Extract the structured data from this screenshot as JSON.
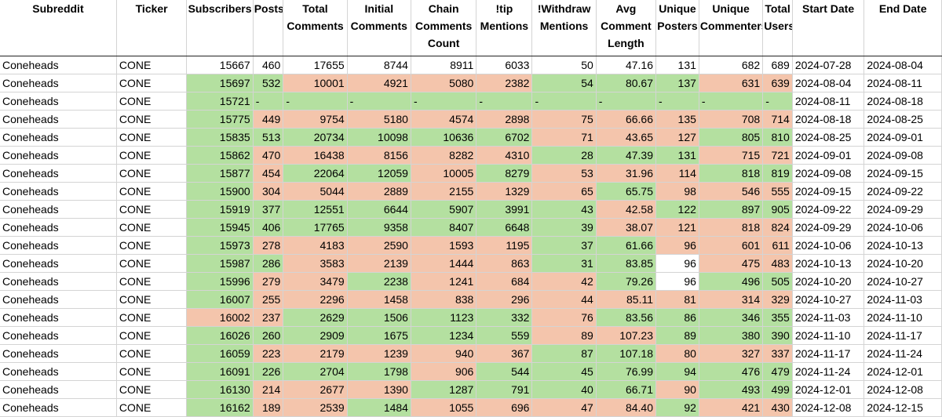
{
  "colors": {
    "green": "#b4e0a0",
    "salmon": "#f4c5ac"
  },
  "headers": [
    "Subreddit",
    "Ticker",
    "Subscribers",
    "Posts",
    "Total Comments",
    "Initial Comments",
    "Chain Comments Count",
    "!tip Mentions",
    "!Withdraw Mentions",
    "Avg Comment Length",
    "Unique Posters",
    "Unique Commenters",
    "Total Users",
    "Start Date",
    "End Date"
  ],
  "rows": [
    {
      "cells": [
        "Coneheads",
        "CONE",
        "15667",
        "460",
        "17655",
        "8744",
        "8911",
        "6033",
        "50",
        "47.16",
        "131",
        "682",
        "689",
        "2024-07-28",
        "2024-08-04"
      ],
      "shade": [
        "",
        "",
        "",
        "",
        "",
        "",
        "",
        "",
        "",
        "",
        "",
        "",
        "",
        "",
        ""
      ]
    },
    {
      "cells": [
        "Coneheads",
        "CONE",
        "15697",
        "532",
        "10001",
        "4921",
        "5080",
        "2382",
        "54",
        "80.67",
        "137",
        "631",
        "639",
        "2024-08-04",
        "2024-08-11"
      ],
      "shade": [
        "",
        "",
        "g",
        "g",
        "p",
        "p",
        "p",
        "p",
        "g",
        "g",
        "g",
        "p",
        "p",
        "",
        ""
      ]
    },
    {
      "cells": [
        "Coneheads",
        "CONE",
        "15721",
        "-",
        "-",
        "-",
        "-",
        "-",
        "-",
        "-",
        "-",
        "-",
        "-",
        "2024-08-11",
        "2024-08-18"
      ],
      "shade": [
        "",
        "",
        "g",
        "g",
        "g",
        "g",
        "g",
        "g",
        "g",
        "g",
        "g",
        "g",
        "g",
        "",
        ""
      ]
    },
    {
      "cells": [
        "Coneheads",
        "CONE",
        "15775",
        "449",
        "9754",
        "5180",
        "4574",
        "2898",
        "75",
        "66.66",
        "135",
        "708",
        "714",
        "2024-08-18",
        "2024-08-25"
      ],
      "shade": [
        "",
        "",
        "g",
        "p",
        "p",
        "p",
        "p",
        "p",
        "p",
        "p",
        "p",
        "p",
        "p",
        "",
        ""
      ]
    },
    {
      "cells": [
        "Coneheads",
        "CONE",
        "15835",
        "513",
        "20734",
        "10098",
        "10636",
        "6702",
        "71",
        "43.65",
        "127",
        "805",
        "810",
        "2024-08-25",
        "2024-09-01"
      ],
      "shade": [
        "",
        "",
        "g",
        "g",
        "g",
        "g",
        "g",
        "g",
        "p",
        "p",
        "p",
        "g",
        "g",
        "",
        ""
      ]
    },
    {
      "cells": [
        "Coneheads",
        "CONE",
        "15862",
        "470",
        "16438",
        "8156",
        "8282",
        "4310",
        "28",
        "47.39",
        "131",
        "715",
        "721",
        "2024-09-01",
        "2024-09-08"
      ],
      "shade": [
        "",
        "",
        "g",
        "p",
        "p",
        "p",
        "p",
        "p",
        "g",
        "g",
        "g",
        "p",
        "p",
        "",
        ""
      ]
    },
    {
      "cells": [
        "Coneheads",
        "CONE",
        "15877",
        "454",
        "22064",
        "12059",
        "10005",
        "8279",
        "53",
        "31.96",
        "114",
        "818",
        "819",
        "2024-09-08",
        "2024-09-15"
      ],
      "shade": [
        "",
        "",
        "g",
        "p",
        "g",
        "g",
        "p",
        "g",
        "p",
        "p",
        "p",
        "g",
        "g",
        "",
        ""
      ]
    },
    {
      "cells": [
        "Coneheads",
        "CONE",
        "15900",
        "304",
        "5044",
        "2889",
        "2155",
        "1329",
        "65",
        "65.75",
        "98",
        "546",
        "555",
        "2024-09-15",
        "2024-09-22"
      ],
      "shade": [
        "",
        "",
        "g",
        "p",
        "p",
        "p",
        "p",
        "p",
        "p",
        "g",
        "p",
        "p",
        "p",
        "",
        ""
      ]
    },
    {
      "cells": [
        "Coneheads",
        "CONE",
        "15919",
        "377",
        "12551",
        "6644",
        "5907",
        "3991",
        "43",
        "42.58",
        "122",
        "897",
        "905",
        "2024-09-22",
        "2024-09-29"
      ],
      "shade": [
        "",
        "",
        "g",
        "g",
        "g",
        "g",
        "g",
        "g",
        "g",
        "p",
        "g",
        "g",
        "g",
        "",
        ""
      ]
    },
    {
      "cells": [
        "Coneheads",
        "CONE",
        "15945",
        "406",
        "17765",
        "9358",
        "8407",
        "6648",
        "39",
        "38.07",
        "121",
        "818",
        "824",
        "2024-09-29",
        "2024-10-06"
      ],
      "shade": [
        "",
        "",
        "g",
        "g",
        "g",
        "g",
        "g",
        "g",
        "g",
        "p",
        "p",
        "p",
        "p",
        "",
        ""
      ]
    },
    {
      "cells": [
        "Coneheads",
        "CONE",
        "15973",
        "278",
        "4183",
        "2590",
        "1593",
        "1195",
        "37",
        "61.66",
        "96",
        "601",
        "611",
        "2024-10-06",
        "2024-10-13"
      ],
      "shade": [
        "",
        "",
        "g",
        "p",
        "p",
        "p",
        "p",
        "p",
        "g",
        "g",
        "p",
        "p",
        "p",
        "",
        ""
      ]
    },
    {
      "cells": [
        "Coneheads",
        "CONE",
        "15987",
        "286",
        "3583",
        "2139",
        "1444",
        "863",
        "31",
        "83.85",
        "96",
        "475",
        "483",
        "2024-10-13",
        "2024-10-20"
      ],
      "shade": [
        "",
        "",
        "g",
        "g",
        "p",
        "p",
        "p",
        "p",
        "g",
        "g",
        "w",
        "p",
        "p",
        "",
        ""
      ]
    },
    {
      "cells": [
        "Coneheads",
        "CONE",
        "15996",
        "279",
        "3479",
        "2238",
        "1241",
        "684",
        "42",
        "79.26",
        "96",
        "496",
        "505",
        "2024-10-20",
        "2024-10-27"
      ],
      "shade": [
        "",
        "",
        "g",
        "p",
        "p",
        "g",
        "p",
        "p",
        "p",
        "g",
        "w",
        "g",
        "g",
        "",
        ""
      ]
    },
    {
      "cells": [
        "Coneheads",
        "CONE",
        "16007",
        "255",
        "2296",
        "1458",
        "838",
        "296",
        "44",
        "85.11",
        "81",
        "314",
        "329",
        "2024-10-27",
        "2024-11-03"
      ],
      "shade": [
        "",
        "",
        "g",
        "p",
        "p",
        "p",
        "p",
        "p",
        "p",
        "p",
        "p",
        "p",
        "p",
        "",
        ""
      ]
    },
    {
      "cells": [
        "Coneheads",
        "CONE",
        "16002",
        "237",
        "2629",
        "1506",
        "1123",
        "332",
        "76",
        "83.56",
        "86",
        "346",
        "355",
        "2024-11-03",
        "2024-11-10"
      ],
      "shade": [
        "",
        "",
        "p",
        "p",
        "g",
        "g",
        "g",
        "g",
        "p",
        "g",
        "g",
        "g",
        "g",
        "",
        ""
      ]
    },
    {
      "cells": [
        "Coneheads",
        "CONE",
        "16026",
        "260",
        "2909",
        "1675",
        "1234",
        "559",
        "89",
        "107.23",
        "89",
        "380",
        "390",
        "2024-11-10",
        "2024-11-17"
      ],
      "shade": [
        "",
        "",
        "g",
        "g",
        "g",
        "g",
        "g",
        "g",
        "p",
        "p",
        "g",
        "g",
        "g",
        "",
        ""
      ]
    },
    {
      "cells": [
        "Coneheads",
        "CONE",
        "16059",
        "223",
        "2179",
        "1239",
        "940",
        "367",
        "87",
        "107.18",
        "80",
        "327",
        "337",
        "2024-11-17",
        "2024-11-24"
      ],
      "shade": [
        "",
        "",
        "g",
        "p",
        "p",
        "p",
        "p",
        "p",
        "g",
        "g",
        "p",
        "p",
        "p",
        "",
        ""
      ]
    },
    {
      "cells": [
        "Coneheads",
        "CONE",
        "16091",
        "226",
        "2704",
        "1798",
        "906",
        "544",
        "45",
        "76.99",
        "94",
        "476",
        "479",
        "2024-11-24",
        "2024-12-01"
      ],
      "shade": [
        "",
        "",
        "g",
        "g",
        "g",
        "g",
        "p",
        "g",
        "g",
        "g",
        "g",
        "g",
        "g",
        "",
        ""
      ]
    },
    {
      "cells": [
        "Coneheads",
        "CONE",
        "16130",
        "214",
        "2677",
        "1390",
        "1287",
        "791",
        "40",
        "66.71",
        "90",
        "493",
        "499",
        "2024-12-01",
        "2024-12-08"
      ],
      "shade": [
        "",
        "",
        "g",
        "p",
        "p",
        "p",
        "g",
        "g",
        "g",
        "g",
        "p",
        "g",
        "g",
        "",
        ""
      ]
    },
    {
      "cells": [
        "Coneheads",
        "CONE",
        "16162",
        "189",
        "2539",
        "1484",
        "1055",
        "696",
        "47",
        "84.40",
        "92",
        "421",
        "430",
        "2024-12-08",
        "2024-12-15"
      ],
      "shade": [
        "",
        "",
        "g",
        "p",
        "p",
        "g",
        "p",
        "p",
        "p",
        "p",
        "g",
        "p",
        "p",
        "",
        ""
      ]
    }
  ]
}
